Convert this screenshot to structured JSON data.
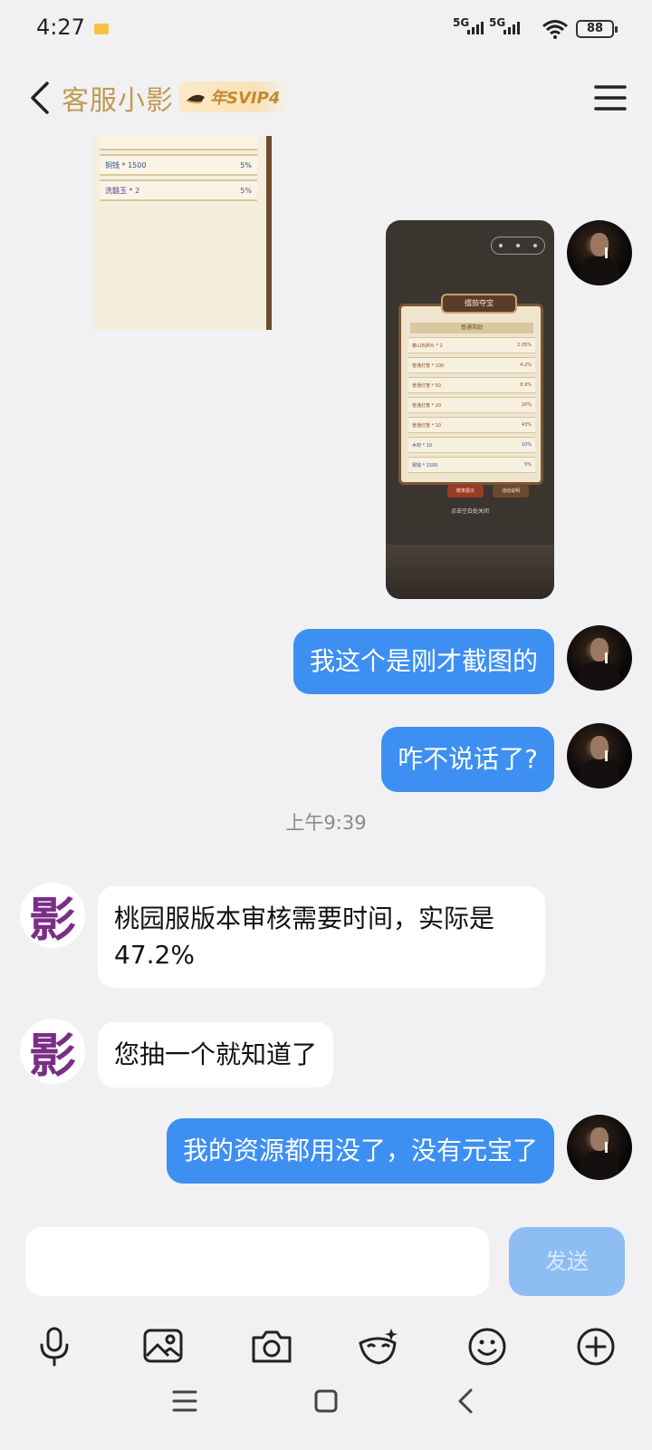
{
  "status_bar": {
    "time": "4:27",
    "network1": "5G",
    "network2": "5G",
    "battery": "88"
  },
  "header": {
    "title": "客服小影",
    "vip_badge": "年SVIP4"
  },
  "chat": {
    "partial_image_rows": [
      {
        "name": "铜钱 * 1500",
        "pct": "5%"
      },
      {
        "name": "洗髓玉 * 2",
        "pct": "5%"
      }
    ],
    "screenshot": {
      "panel_title": "擂鼓夺宝",
      "section_title": "普通奖励",
      "rows": [
        {
          "name": "泰山石碎片 * 2",
          "pct": "2.05%"
        },
        {
          "name": "普通灯笼 * 100",
          "pct": "4.2%"
        },
        {
          "name": "普通灯笼 * 50",
          "pct": "8.9%"
        },
        {
          "name": "普通灯笼 * 20",
          "pct": "20%"
        },
        {
          "name": "普通灯笼 * 10",
          "pct": "43%"
        },
        {
          "name": "木材 * 10",
          "pct": "10%"
        },
        {
          "name": "铜钱 * 1500",
          "pct": "5%"
        }
      ],
      "buttons": [
        "概率展示",
        "活动说明"
      ],
      "close_hint": "点击空白处关闭"
    },
    "avatar_cs_glyph": "影",
    "messages": [
      {
        "from": "me",
        "text": "我这个是刚才截图的"
      },
      {
        "from": "me",
        "text": "咋不说话了?"
      },
      {
        "from": "cs",
        "text": "桃园服版本审核需要时间，实际是47.2%"
      },
      {
        "from": "cs",
        "text": "您抽一个就知道了"
      },
      {
        "from": "me",
        "text": "我的资源都用没了，没有元宝了"
      }
    ],
    "timestamp": "上午9:39"
  },
  "input": {
    "placeholder": "",
    "send_label": "发送"
  },
  "toolbar": {
    "tools": [
      "microphone-icon",
      "image-icon",
      "camera-icon",
      "mask-icon",
      "emoji-icon",
      "plus-icon"
    ]
  },
  "colors": {
    "accent_blue": "#3d8ff2",
    "send_disabled": "#8dbdf3",
    "title_gold": "#c19a52",
    "cs_avatar_purple": "#7a2e86"
  }
}
